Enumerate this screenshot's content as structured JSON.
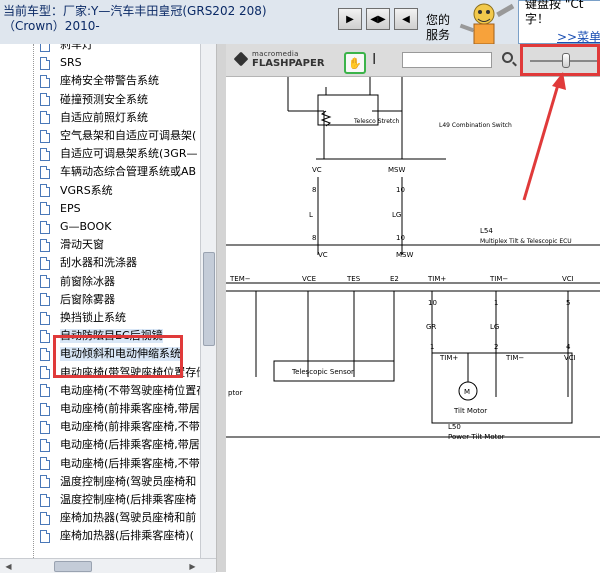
{
  "header": {
    "car_type_line1": "当前车型：厂家:Y—汽车丰田皇冠(GRS202 208)",
    "car_type_line2": "（Crown）2010-",
    "service_line1": "您的",
    "service_line2": "服务",
    "bubble_line1": "键盘按 \"Ct",
    "bubble_line2": "字！",
    "bubble_link": ">>菜单"
  },
  "sidebar": {
    "items": [
      {
        "label": "刹车灯"
      },
      {
        "label": "SRS"
      },
      {
        "label": "座椅安全带警告系统"
      },
      {
        "label": "碰撞预测安全系统"
      },
      {
        "label": "自适应前照灯系统"
      },
      {
        "label": "空气悬架和自适应可调悬架("
      },
      {
        "label": "自适应可调悬架系统(3GR—"
      },
      {
        "label": "车辆动态综合管理系统或AB"
      },
      {
        "label": "VGRS系统"
      },
      {
        "label": "EPS"
      },
      {
        "label": "G—BOOK"
      },
      {
        "label": "滑动天窗"
      },
      {
        "label": "刮水器和洗涤器"
      },
      {
        "label": "前窗除冰器"
      },
      {
        "label": "后窗除雾器"
      },
      {
        "label": "换挡锁止系统"
      },
      {
        "label": "自动防眩目EC后视镜"
      },
      {
        "label": "电动倾斜和电动伸缩系统"
      },
      {
        "label": "电动座椅(带驾驶座椅位置存储器"
      },
      {
        "label": "电动座椅(不带驾驶座椅位置存储"
      },
      {
        "label": "电动座椅(前排乘客座椅,带居"
      },
      {
        "label": "电动座椅(前排乘客座椅,不带"
      },
      {
        "label": "电动座椅(后排乘客座椅,带居"
      },
      {
        "label": "电动座椅(后排乘客座椅,不带"
      },
      {
        "label": "温度控制座椅(驾驶员座椅和"
      },
      {
        "label": "温度控制座椅(后排乘客座椅"
      },
      {
        "label": "座椅加热器(驾驶员座椅和前"
      },
      {
        "label": "座椅加热器(后排乘客座椅)("
      }
    ],
    "selected_index": 17
  },
  "viewer": {
    "logo_top": "macromedia",
    "logo_bottom": "FLASHPAPER"
  },
  "diagram": {
    "telescopic_stretch": "Telesco Stretch",
    "combination_switch": "L49 Combination Switch",
    "vc": "VC",
    "msw": "MSW",
    "pin_8": "8",
    "pin_10": "10",
    "wire_l": "L",
    "wire_lg": "LG",
    "l54": "L54",
    "ecu": "Multiplex Tilt & Telescopic ECU",
    "tem": "TEM−",
    "vce": "VCE",
    "tes": "TES",
    "e2": "E2",
    "timp": "TIM+",
    "timm": "TIM−",
    "vci": "VCI",
    "pin_1": "1",
    "pin_2": "2",
    "pin_4": "4",
    "pin_5": "5",
    "wire_gr": "GR",
    "telescopic_sensor": "Telescopic Sensor",
    "sensor_side": "ptor",
    "motor_m": "M",
    "tilt_motor": "Tilt Motor",
    "l50": "L50",
    "power_tilt_motor": "Power Tilt Motor"
  },
  "colors": {
    "highlight": "#e03a3a",
    "header_bg": "#dfe6ee",
    "link": "#1a4fb3"
  }
}
